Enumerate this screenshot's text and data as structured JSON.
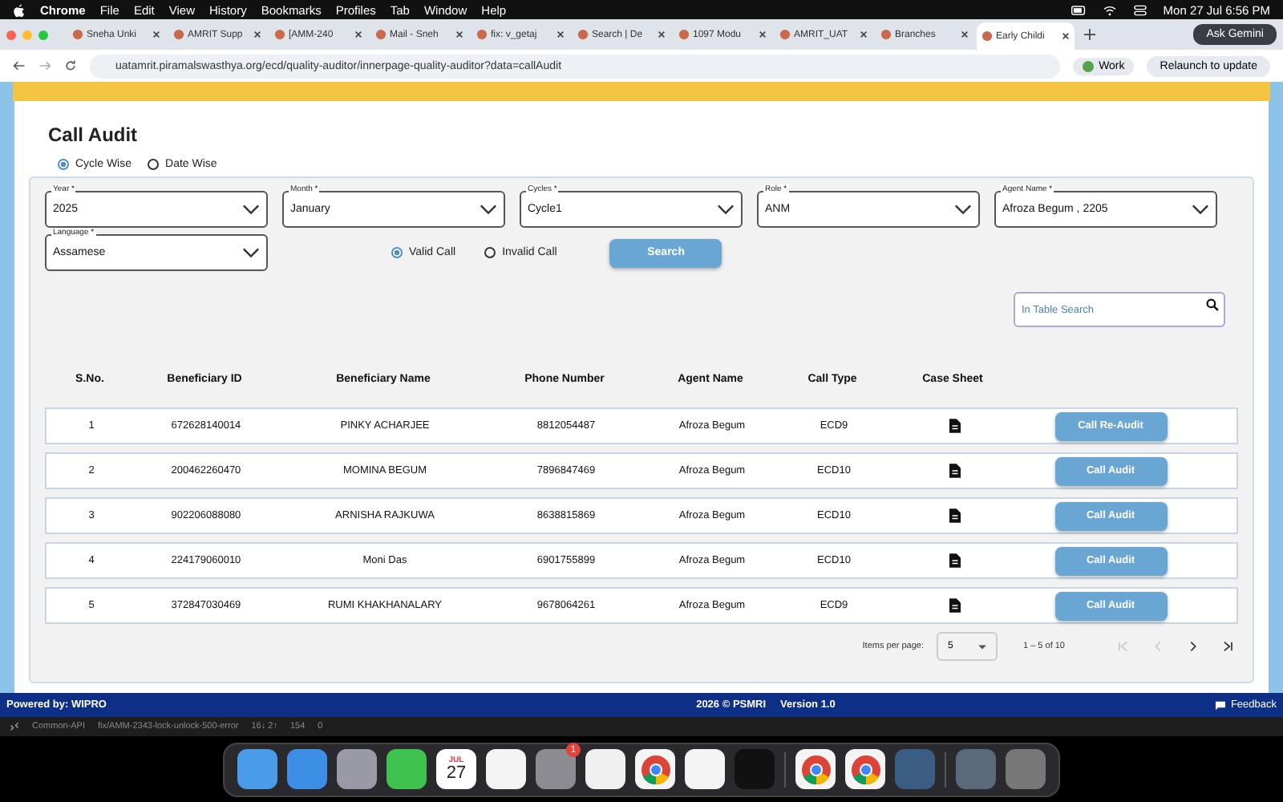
{
  "menu_bar": {
    "app": "Chrome",
    "menus": [
      "File",
      "Edit",
      "View",
      "History",
      "Bookmarks",
      "Profiles",
      "Tab",
      "Window",
      "Help"
    ],
    "clock": "Mon 27 Jul  6:56 PM"
  },
  "tabs": [
    {
      "label": "Sneha Unki",
      "selected": false
    },
    {
      "label": "AMRIT Supp",
      "selected": false
    },
    {
      "label": "[AMM-240",
      "selected": false
    },
    {
      "label": "Mail - Sneh",
      "selected": false
    },
    {
      "label": "fix: v_getaj",
      "selected": false
    },
    {
      "label": "Search | De",
      "selected": false
    },
    {
      "label": "1097 Modu",
      "selected": false
    },
    {
      "label": "AMRIT_UAT",
      "selected": false
    },
    {
      "label": "Branches",
      "selected": false
    },
    {
      "label": "Early Childi",
      "selected": true
    }
  ],
  "gemini_button": "Ask Gemini",
  "address_bar": {
    "url": "uatamrit.piramalswasthya.org/ecd/quality-auditor/innerpage-quality-auditor?data=callAudit",
    "profile": "Work",
    "relaunch": "Relaunch to update"
  },
  "page": {
    "title": "Call Audit",
    "modes": [
      {
        "label": "Cycle Wise",
        "selected": true
      },
      {
        "label": "Date Wise",
        "selected": false
      }
    ],
    "filters": [
      {
        "label": "Year *",
        "value": "2025"
      },
      {
        "label": "Month *",
        "value": "January"
      },
      {
        "label": "Cycles *",
        "value": "Cycle1"
      },
      {
        "label": "Role *",
        "value": "ANM"
      },
      {
        "label": "Agent Name *",
        "value": "Afroza Begum , 2205"
      },
      {
        "label": "Language *",
        "value": "Assamese"
      }
    ],
    "call_types": [
      {
        "label": "Valid Call",
        "selected": true
      },
      {
        "label": "Invalid Call",
        "selected": false
      }
    ],
    "search_button": "Search",
    "table_search": {
      "placeholder": "In Table Search"
    },
    "table": {
      "columns": [
        "S.No.",
        "Beneficiary ID",
        "Beneficiary Name",
        "Phone Number",
        "Agent Name",
        "Call Type",
        "Case Sheet"
      ],
      "rows": [
        {
          "sno": "1",
          "beneficiary_id": "672628140014",
          "name": "PINKY ACHARJEE",
          "phone": "8812054487",
          "agent": "Afroza Begum",
          "call_type": "ECD9",
          "action": "Call Re-Audit"
        },
        {
          "sno": "2",
          "beneficiary_id": "200462260470",
          "name": "MOMINA BEGUM",
          "phone": "7896847469",
          "agent": "Afroza Begum",
          "call_type": "ECD10",
          "action": "Call Audit"
        },
        {
          "sno": "3",
          "beneficiary_id": "902206088080",
          "name": "ARNISHA RAJKUWA",
          "phone": "8638815869",
          "agent": "Afroza Begum",
          "call_type": "ECD10",
          "action": "Call Audit"
        },
        {
          "sno": "4",
          "beneficiary_id": "224179060010",
          "name": "Moni Das",
          "phone": "6901755899",
          "agent": "Afroza Begum",
          "call_type": "ECD10",
          "action": "Call Audit"
        },
        {
          "sno": "5",
          "beneficiary_id": "372847030469",
          "name": "RUMI KHAKHANALARY",
          "phone": "9678064261",
          "agent": "Afroza Begum",
          "call_type": "ECD9",
          "action": "Call Audit"
        }
      ]
    },
    "pagination": {
      "items_per_page_label": "Items per page:",
      "items_per_page": "5",
      "range": "1 – 5 of 10",
      "nav": [
        {
          "kind": "first",
          "disabled": true
        },
        {
          "kind": "prev",
          "disabled": true
        },
        {
          "kind": "next",
          "disabled": false
        },
        {
          "kind": "last",
          "disabled": false
        }
      ]
    }
  },
  "footer": {
    "powered_by": "Powered by: WIPRO",
    "copyright": "2026 © PSMRI",
    "version": "Version 1.0",
    "feedback": "Feedback"
  },
  "status_bar": {
    "repo": "Common-API",
    "branch": "fix/AMM-2343-lock-unlock-500-error",
    "sync": "16↓ 2↑",
    "errors": "154",
    "warnings": "0"
  },
  "dock": {
    "items": [
      {
        "kind": "finder"
      },
      {
        "kind": "mail"
      },
      {
        "kind": "launchpad"
      },
      {
        "kind": "facetime"
      },
      {
        "kind": "calendar",
        "month": "JUL",
        "day": "27"
      },
      {
        "kind": "reminders"
      },
      {
        "kind": "settings",
        "badge": "1"
      },
      {
        "kind": "postman"
      },
      {
        "kind": "chrome"
      },
      {
        "kind": "vscode"
      },
      {
        "kind": "terminal"
      },
      {
        "kind": "separator"
      },
      {
        "kind": "chrome"
      },
      {
        "kind": "chrome"
      },
      {
        "kind": "mysql"
      },
      {
        "kind": "separator"
      },
      {
        "kind": "downloads"
      },
      {
        "kind": "trash"
      }
    ]
  }
}
